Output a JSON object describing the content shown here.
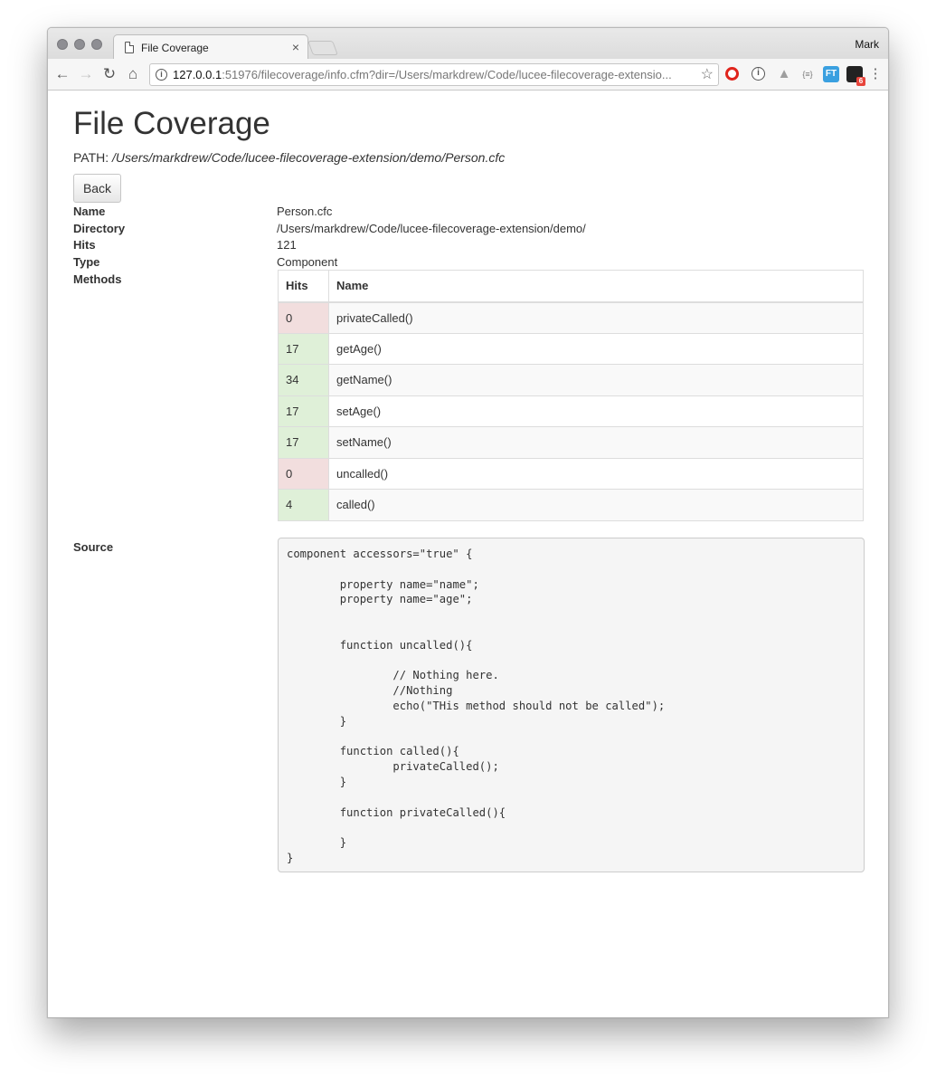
{
  "browser": {
    "tab_title": "File Coverage",
    "tab_close": "×",
    "profile_name": "Mark",
    "url_host": "127.0.0.1",
    "url_rest": ":51976/filecoverage/info.cfm?dir=/Users/markdrew/Code/lucee-filecoverage-extensio...",
    "extensions": [
      "opera-icon",
      "info-circle-icon",
      "drive-icon",
      "json-viewer-icon",
      "ft-icon",
      "sixth-icon"
    ],
    "extension_badge": "6"
  },
  "page": {
    "title": "File Coverage",
    "path_label": "PATH:",
    "path_value": "/Users/markdrew/Code/lucee-filecoverage-extension/demo/Person.cfc",
    "back_label": "Back"
  },
  "details": {
    "name_label": "Name",
    "name_value": "Person.cfc",
    "directory_label": "Directory",
    "directory_value": "/Users/markdrew/Code/lucee-filecoverage-extension/demo/",
    "hits_label": "Hits",
    "hits_value": "121",
    "type_label": "Type",
    "type_value": "Component",
    "methods_label": "Methods",
    "source_label": "Source"
  },
  "methods": {
    "headers": {
      "hits": "Hits",
      "name": "Name"
    },
    "rows": [
      {
        "hits": "0",
        "name": "privateCalled()"
      },
      {
        "hits": "17",
        "name": "getAge()"
      },
      {
        "hits": "34",
        "name": "getName()"
      },
      {
        "hits": "17",
        "name": "setAge()"
      },
      {
        "hits": "17",
        "name": "setName()"
      },
      {
        "hits": "0",
        "name": "uncalled()"
      },
      {
        "hits": "4",
        "name": "called()"
      }
    ]
  },
  "source_code": "component accessors=\"true\" {\n\n\tproperty name=\"name\";\n\tproperty name=\"age\";\n\n\n\tfunction uncalled(){\n\n\t\t// Nothing here.\n\t\t//Nothing\n\t\techo(\"THis method should not be called\");\n\t}\n\n\tfunction called(){\n\t\tprivateCalled();\n\t}\n\n\tfunction privateCalled(){\n\n\t}\n}",
  "colors": {
    "hit_zero": "#f2dede",
    "hit_positive": "#dff0d8"
  }
}
